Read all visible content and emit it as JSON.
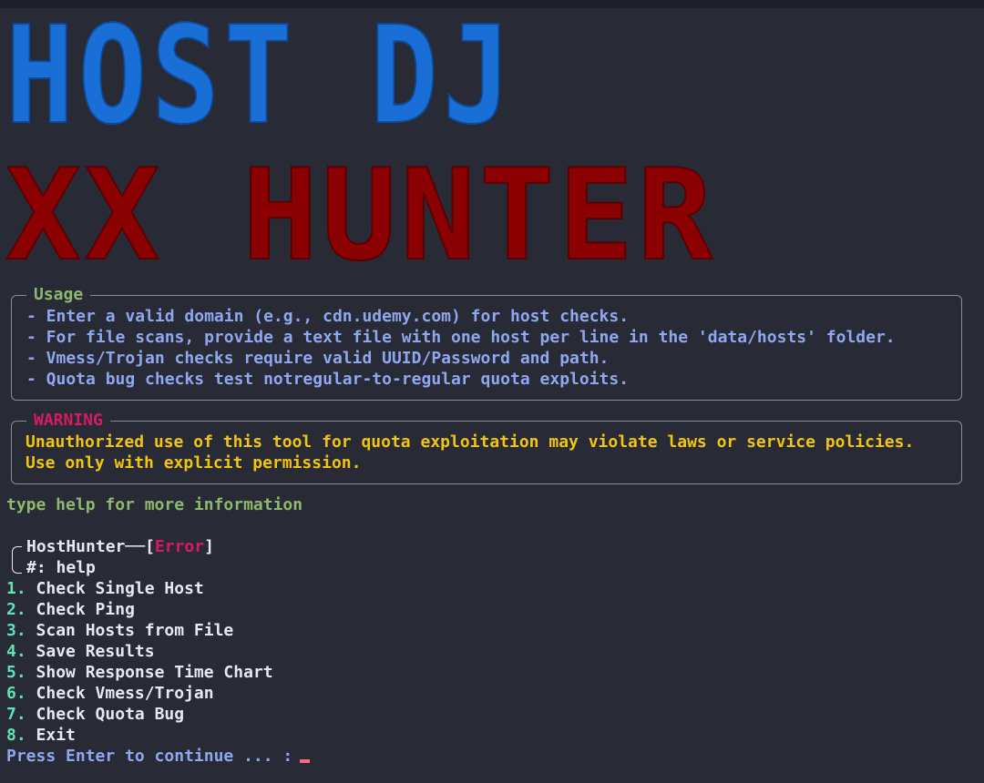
{
  "banner": {
    "line1": "HOST DJ",
    "line2": "XX HUNTER",
    "line1_color": "#1a6fd6",
    "line2_color": "#8b0000"
  },
  "usage": {
    "title": "Usage",
    "lines": [
      "- Enter a valid domain (e.g., cdn.udemy.com) for host checks.",
      "- For file scans, provide a text file with one host per line in the 'data/hosts' folder.",
      "- Vmess/Trojan checks require valid UUID/Password and path.",
      "- Quota bug checks test notregular-to-regular quota exploits."
    ]
  },
  "warning": {
    "title": "WARNING",
    "lines": [
      "Unauthorized use of this tool for quota exploitation may violate laws or service policies.",
      "Use only with explicit permission."
    ]
  },
  "hint": "type help for more information",
  "prompt": {
    "name": "HostHunter",
    "dash": "──",
    "open": "[",
    "status": "Error",
    "close": "]",
    "symbol": "#:",
    "command": "help"
  },
  "menu": [
    {
      "num": "1.",
      "label": "Check Single Host"
    },
    {
      "num": "2.",
      "label": "Check Ping"
    },
    {
      "num": "3.",
      "label": "Scan Hosts from File"
    },
    {
      "num": "4.",
      "label": "Save Results"
    },
    {
      "num": "5.",
      "label": "Show Response Time Chart"
    },
    {
      "num": "6.",
      "label": "Check Vmess/Trojan"
    },
    {
      "num": "7.",
      "label": "Check Quota Bug"
    },
    {
      "num": "8.",
      "label": "Exit"
    }
  ],
  "continue_prompt": "Press Enter to continue ... :"
}
